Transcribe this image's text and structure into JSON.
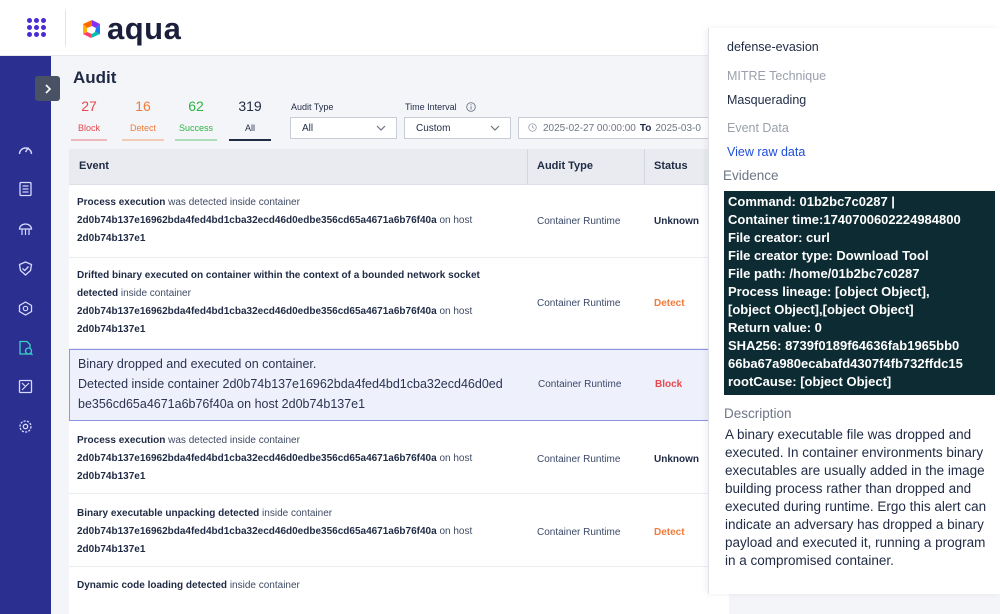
{
  "app": {
    "logo_text": "aqua"
  },
  "page": {
    "title": "Audit"
  },
  "stats": [
    {
      "value": "27",
      "label": "Block",
      "color": "#e5484d"
    },
    {
      "value": "16",
      "label": "Detect",
      "color": "#f07c3a"
    },
    {
      "value": "62",
      "label": "Success",
      "color": "#2fb344"
    },
    {
      "value": "319",
      "label": "All",
      "color": "#1f2a44"
    }
  ],
  "filters": {
    "audit_type_label": "Audit Type",
    "audit_type_value": "All",
    "time_interval_label": "Time Interval",
    "time_interval_value": "Custom",
    "date_from": "2025-02-27 00:00:00",
    "date_to_label": "To",
    "date_to": "2025-03-0"
  },
  "table": {
    "headers": {
      "event": "Event",
      "audit_type": "Audit Type",
      "status": "Status"
    },
    "rows": [
      {
        "event_bold": "Process execution",
        "event_mid": " was detected inside container",
        "line2": "2d0b74b137e16962bda4fed4bd1cba32ecd46d0edbe356cd65a4671a6b76f40a",
        "line2_suffix": " on host",
        "line3": "2d0b74b137e1",
        "audit_type": "Container Runtime",
        "status": "Unknown"
      },
      {
        "event_bold": "Drifted binary executed on container within the context of a bounded network socket",
        "line_b": "detected",
        "line_b_suffix": " inside container",
        "line2": "2d0b74b137e16962bda4fed4bd1cba32ecd46d0edbe356cd65a4671a6b76f40a",
        "line2_suffix": " on host",
        "line3": "2d0b74b137e1",
        "audit_type": "Container Runtime",
        "status": "Detect"
      },
      {
        "line1": "Binary dropped and executed on container.",
        "line2": "Detected inside container 2d0b74b137e16962bda4fed4bd1cba32ecd46d0ed",
        "line3": "be356cd65a4671a6b76f40a on host 2d0b74b137e1",
        "audit_type": "Container Runtime",
        "status": "Block"
      },
      {
        "event_bold": "Process execution",
        "event_mid": " was detected inside container",
        "line2": "2d0b74b137e16962bda4fed4bd1cba32ecd46d0edbe356cd65a4671a6b76f40a",
        "line2_suffix": " on host",
        "line3": "2d0b74b137e1",
        "audit_type": "Container Runtime",
        "status": "Unknown"
      },
      {
        "event_bold": "Binary executable unpacking detected",
        "event_mid": " inside container",
        "line2": "2d0b74b137e16962bda4fed4bd1cba32ecd46d0edbe356cd65a4671a6b76f40a",
        "line2_suffix": " on host",
        "line3": "2d0b74b137e1",
        "audit_type": "Container Runtime",
        "status": "Detect"
      },
      {
        "event_bold": "Dynamic code loading detected",
        "event_mid": " inside container"
      }
    ]
  },
  "status_colors": {
    "Unknown": "#1f2a44",
    "Detect": "#f07c3a",
    "Block": "#e5484d"
  },
  "panel": {
    "tactic_value": "defense-evasion",
    "technique_label": "MITRE Technique",
    "technique_value": "Masquerading",
    "event_data_label": "Event Data",
    "view_raw_link": "View raw data",
    "evidence_label": "Evidence",
    "evidence_lines": [
      "Command: 01b2bc7c0287 |",
      "Container time:1740700602224984800",
      "File creator: curl",
      "File creator type: Download Tool",
      "File path: /home/01b2bc7c0287",
      "Process lineage: [object Object],",
      "[object Object],[object Object]",
      "Return value: 0",
      "SHA256: 8739f0189f64636fab1965bb0",
      "66ba67a980ecabafd4307f4fb732ffdc15",
      "rootCause: [object Object]"
    ],
    "description_label": "Description",
    "description_text": "A binary executable file was dropped and executed. In container environments binary executables are usually added in the image building process rather than dropped and executed during runtime. Ergo this alert can indicate an adversary has dropped a binary payload and executed it, running a program in a compromised container."
  }
}
